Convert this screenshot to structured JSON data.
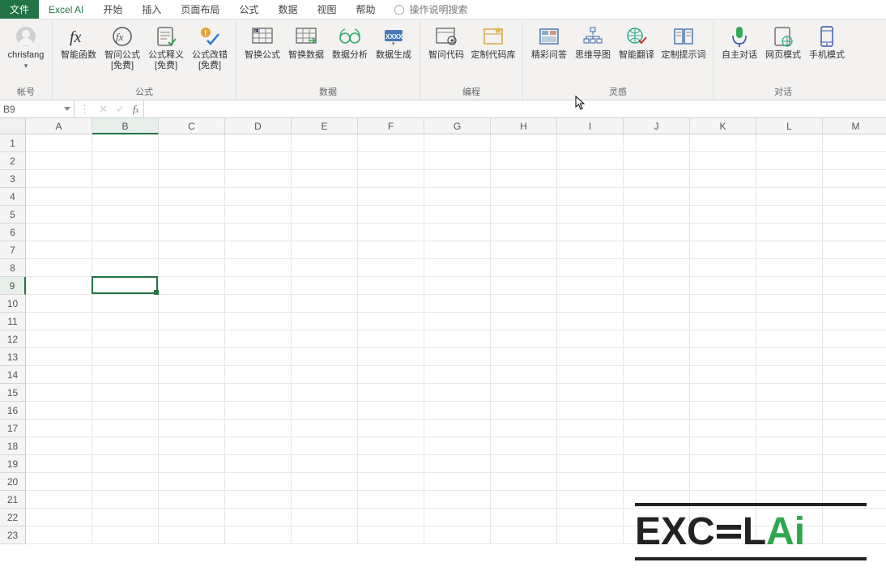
{
  "menu": {
    "file": "文件",
    "active_tab": "Excel AI",
    "items": [
      "开始",
      "插入",
      "页面布局",
      "公式",
      "数据",
      "视图",
      "帮助"
    ],
    "tell_me": "操作说明搜索"
  },
  "ribbon": {
    "account": {
      "username": "chrisfang",
      "label": "帐号"
    },
    "groups": [
      {
        "label": "公式",
        "buttons": [
          {
            "name": "smart-function-button",
            "label": "智能函数",
            "icon": "fx-icon"
          },
          {
            "name": "smart-ask-formula-button",
            "label": "智问公式\n[免费]",
            "icon": "fx-circle-icon"
          },
          {
            "name": "formula-explain-button",
            "label": "公式释义\n[免费]",
            "icon": "doc-check-icon"
          },
          {
            "name": "formula-correct-button",
            "label": "公式改错\n[免费]",
            "icon": "doc-warn-icon"
          }
        ]
      },
      {
        "label": "数据",
        "buttons": [
          {
            "name": "smart-swap-formula-button",
            "label": "智换公式",
            "icon": "sheet-fx-icon"
          },
          {
            "name": "smart-swap-data-button",
            "label": "智换数据",
            "icon": "sheet-arrow-icon"
          },
          {
            "name": "data-analyze-button",
            "label": "数据分析",
            "icon": "glasses-icon"
          },
          {
            "name": "data-generate-button",
            "label": "数据生成",
            "icon": "xxxx-icon"
          }
        ]
      },
      {
        "label": "编程",
        "buttons": [
          {
            "name": "smart-ask-code-button",
            "label": "智问代码",
            "icon": "sheet-gear-icon"
          },
          {
            "name": "custom-code-lib-button",
            "label": "定制代码库",
            "icon": "sheet-star-icon"
          }
        ]
      },
      {
        "label": "灵感",
        "buttons": [
          {
            "name": "brilliant-qa-button",
            "label": "精彩问答",
            "icon": "layout-icon"
          },
          {
            "name": "mindmap-button",
            "label": "思维导图",
            "icon": "org-icon"
          },
          {
            "name": "smart-translate-button",
            "label": "智能翻译",
            "icon": "globe-check-icon"
          },
          {
            "name": "custom-prompt-button",
            "label": "定制提示词",
            "icon": "book-icon"
          }
        ]
      },
      {
        "label": "对话",
        "buttons": [
          {
            "name": "self-dialog-button",
            "label": "自主对话",
            "icon": "mic-icon"
          },
          {
            "name": "web-mode-button",
            "label": "网页模式",
            "icon": "page-web-icon"
          },
          {
            "name": "mobile-mode-button",
            "label": "手机模式",
            "icon": "phone-icon"
          }
        ]
      }
    ]
  },
  "name_box": {
    "value": "B9"
  },
  "formula_bar": {
    "value": ""
  },
  "grid": {
    "columns": [
      "A",
      "B",
      "C",
      "D",
      "E",
      "F",
      "G",
      "H",
      "I",
      "J",
      "K",
      "L",
      "M"
    ],
    "rows": [
      1,
      2,
      3,
      4,
      5,
      6,
      7,
      8,
      9,
      10,
      11,
      12,
      13,
      14,
      15,
      16,
      17,
      18,
      19,
      20,
      21,
      22,
      23
    ],
    "selected_col_index": 1,
    "selected_row_index": 8
  },
  "watermark": {
    "text_left": "EXC",
    "text_right": "L",
    "text_ai": "Ai"
  },
  "colors": {
    "accent": "#217346"
  }
}
